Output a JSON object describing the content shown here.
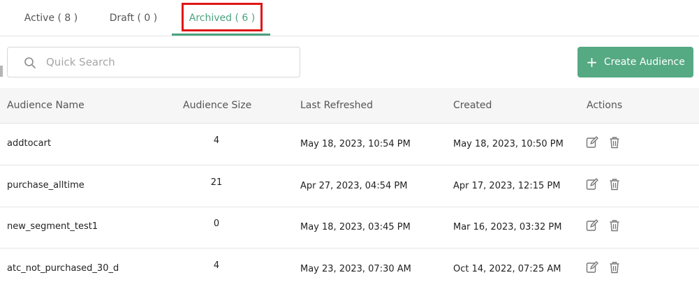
{
  "tabs": [
    {
      "label": "Active ( 8 )"
    },
    {
      "label": "Draft ( 0 )"
    },
    {
      "label": "Archived ( 6 )",
      "active": true
    }
  ],
  "search": {
    "placeholder": "Quick Search",
    "value": ""
  },
  "create_button": {
    "label": "Create Audience",
    "icon": "plus-icon"
  },
  "columns": [
    "Audience Name",
    "Audience Size",
    "Last Refreshed",
    "Created",
    "Actions"
  ],
  "rows": [
    {
      "name": "addtocart",
      "size": "4",
      "last_refreshed": "May 18, 2023, 10:54 PM",
      "created": "May 18, 2023, 10:50 PM"
    },
    {
      "name": "purchase_alltime",
      "size": "21",
      "last_refreshed": "Apr 27, 2023, 04:54 PM",
      "created": "Apr 17, 2023, 12:15 PM"
    },
    {
      "name": "new_segment_test1",
      "size": "0",
      "last_refreshed": "May 18, 2023, 03:45 PM",
      "created": "Mar 16, 2023, 03:32 PM"
    },
    {
      "name": "atc_not_purchased_30_d",
      "size": "4",
      "last_refreshed": "May 23, 2023, 07:30 AM",
      "created": "Oct 14, 2022, 07:25 AM"
    }
  ],
  "row_actions": [
    "edit-icon",
    "trash-icon"
  ],
  "colors": {
    "accent": "#4aa37d",
    "button": "#55a983",
    "highlight": "#e01515"
  }
}
